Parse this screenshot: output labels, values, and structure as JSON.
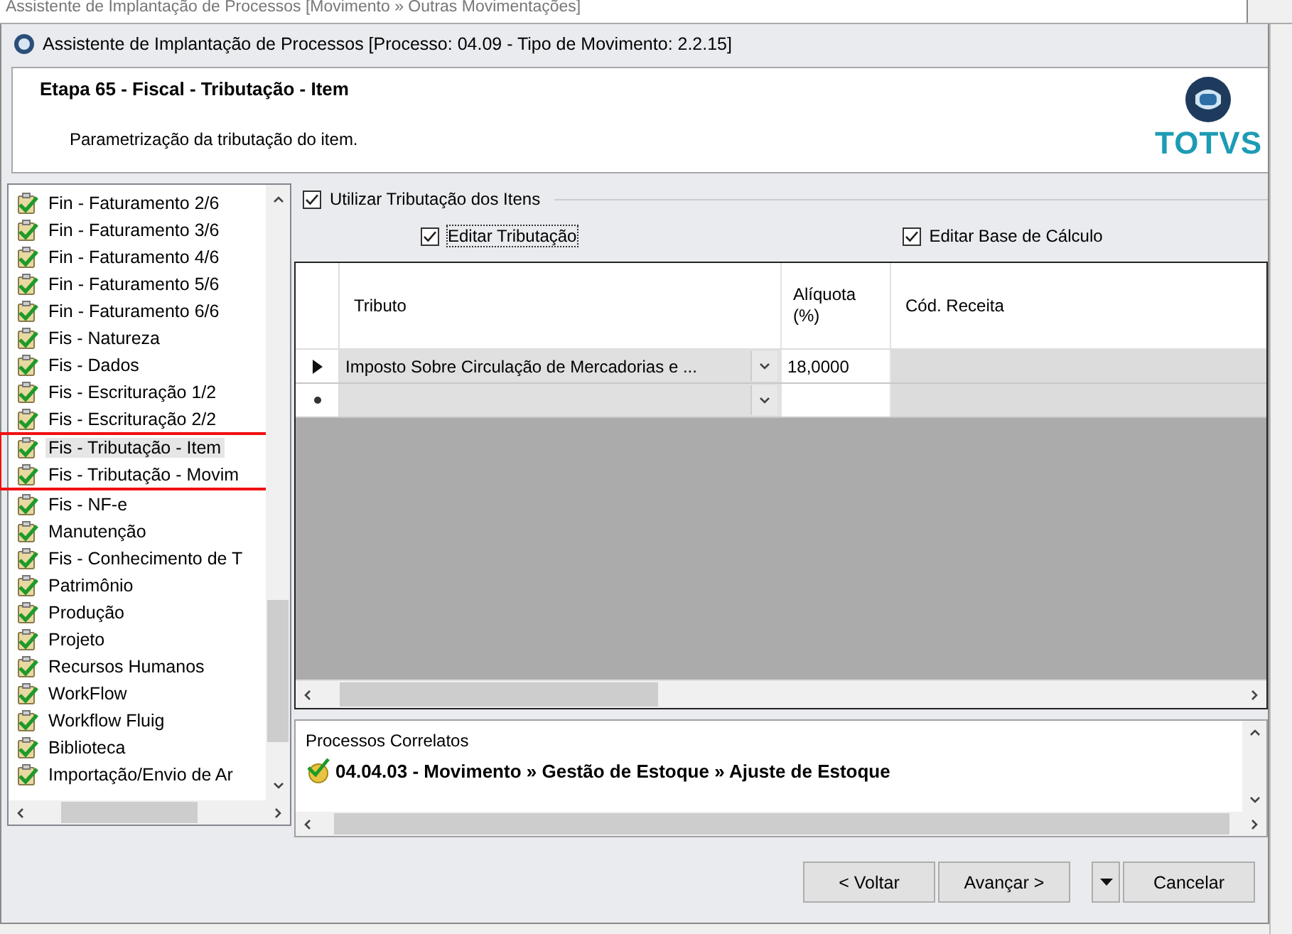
{
  "background_window": {
    "title": "Assistente de Implantação de Processos [Movimento » Outras Movimentações]"
  },
  "window": {
    "title": "Assistente de Implantação de Processos [Processo: 04.09 - Tipo de Movimento: 2.2.15]"
  },
  "header": {
    "step": "Etapa 65 - Fiscal - Tributação - Item",
    "description": "Parametrização da tributação do item.",
    "logo": "TOTVS"
  },
  "steps": [
    {
      "label": "Fin - Faturamento 2/6",
      "done": true,
      "selected": false,
      "highlighted": false
    },
    {
      "label": "Fin - Faturamento 3/6",
      "done": true,
      "selected": false,
      "highlighted": false
    },
    {
      "label": "Fin - Faturamento 4/6",
      "done": true,
      "selected": false,
      "highlighted": false
    },
    {
      "label": "Fin - Faturamento 5/6",
      "done": true,
      "selected": false,
      "highlighted": false
    },
    {
      "label": "Fin - Faturamento 6/6",
      "done": true,
      "selected": false,
      "highlighted": false
    },
    {
      "label": "Fis - Natureza",
      "done": true,
      "selected": false,
      "highlighted": false
    },
    {
      "label": "Fis - Dados",
      "done": true,
      "selected": false,
      "highlighted": false
    },
    {
      "label": "Fis - Escrituração 1/2",
      "done": true,
      "selected": false,
      "highlighted": false
    },
    {
      "label": "Fis - Escrituração 2/2",
      "done": true,
      "selected": false,
      "highlighted": false
    },
    {
      "label": "Fis - Tributação - Item",
      "done": true,
      "selected": true,
      "highlighted": true
    },
    {
      "label": "Fis - Tributação - Movim",
      "done": true,
      "selected": false,
      "highlighted": true
    },
    {
      "label": "Fis - NF-e",
      "done": true,
      "selected": false,
      "highlighted": false
    },
    {
      "label": "Manutenção",
      "done": true,
      "selected": false,
      "highlighted": false
    },
    {
      "label": "Fis - Conhecimento de T",
      "done": true,
      "selected": false,
      "highlighted": false
    },
    {
      "label": "Patrimônio",
      "done": true,
      "selected": false,
      "highlighted": false
    },
    {
      "label": "Produção",
      "done": true,
      "selected": false,
      "highlighted": false
    },
    {
      "label": "Projeto",
      "done": true,
      "selected": false,
      "highlighted": false
    },
    {
      "label": "Recursos Humanos",
      "done": true,
      "selected": false,
      "highlighted": false
    },
    {
      "label": "WorkFlow",
      "done": true,
      "selected": false,
      "highlighted": false
    },
    {
      "label": "Workflow Fluig",
      "done": true,
      "selected": false,
      "highlighted": false
    },
    {
      "label": "Biblioteca",
      "done": true,
      "selected": false,
      "highlighted": false
    },
    {
      "label": "Importação/Envio de Ar",
      "done": true,
      "selected": false,
      "highlighted": false
    }
  ],
  "use_item_taxes": {
    "label": "Utilizar Tributação dos Itens",
    "checked": true
  },
  "options": [
    {
      "label": "Editar Tributação",
      "checked": true,
      "focused": true
    },
    {
      "label": "Editar Base de Cálculo",
      "checked": true,
      "focused": false
    }
  ],
  "grid": {
    "columns": [
      "Tributo",
      "Alíquota (%)",
      "Cód. Receita"
    ],
    "rows": [
      {
        "kind": "current",
        "cells": [
          "Imposto Sobre Circulação de Mercadorias e ...",
          "18,0000"
        ]
      },
      {
        "kind": "new",
        "cells": []
      }
    ]
  },
  "related": {
    "title": "Processos Correlatos",
    "items": [
      "04.04.03 - Movimento » Gestão de Estoque » Ajuste de Estoque"
    ]
  },
  "buttons": [
    {
      "kind": "button",
      "label": "< Voltar"
    },
    {
      "kind": "button",
      "label": "Avançar >"
    },
    {
      "kind": "dropdown"
    },
    {
      "kind": "button",
      "label": "Cancelar"
    }
  ]
}
